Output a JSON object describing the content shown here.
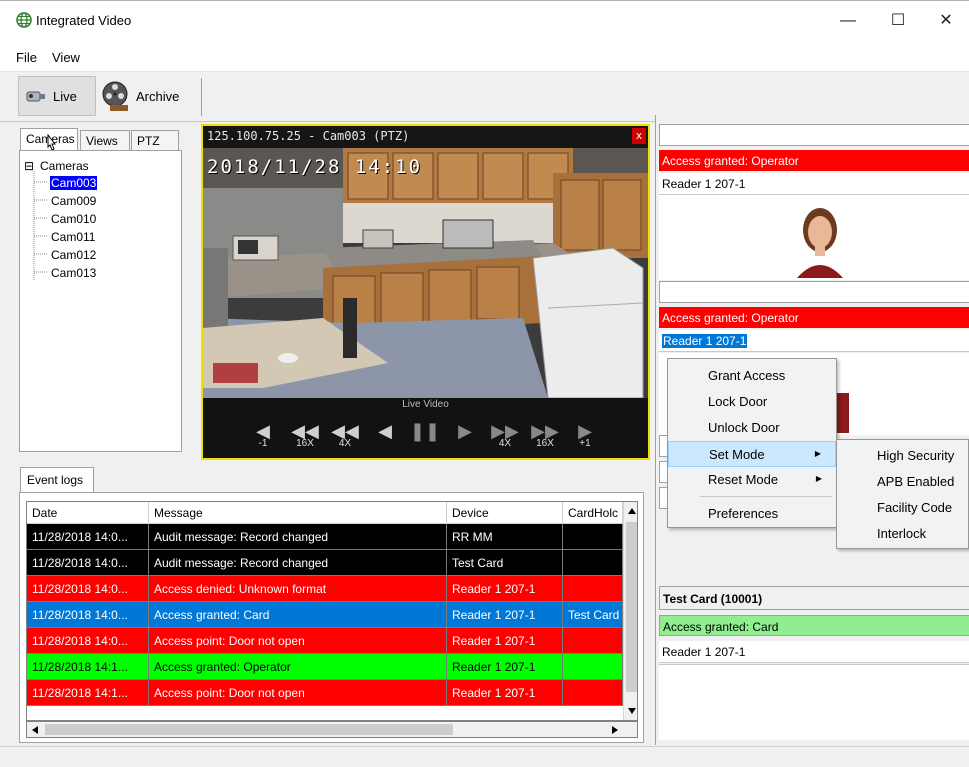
{
  "window": {
    "title": "Integrated Video",
    "minimize": "—",
    "maximize": "☐",
    "close": "✕"
  },
  "menu": {
    "file": "File",
    "view": "View"
  },
  "toolbar": {
    "live": "Live",
    "archive": "Archive"
  },
  "left_tabs": {
    "cameras": "Cameras",
    "views": "Views",
    "ptz": "PTZ"
  },
  "tree": {
    "root": "Cameras",
    "expander": "⊟",
    "items": [
      "Cam003",
      "Cam009",
      "Cam010",
      "Cam011",
      "Cam012",
      "Cam013"
    ]
  },
  "video": {
    "header": "125.100.75.25 - Cam003 (PTZ)",
    "close": "x",
    "timestamp": "2018/11/28 14:10",
    "label": "Live Video",
    "controls": {
      "step_back": "-1",
      "rew16": "16X",
      "rew4": "4X",
      "ff4": "4X",
      "ff16": "16X",
      "step_fwd": "+1"
    }
  },
  "eventlog": {
    "tab": "Event logs",
    "columns": [
      "Date",
      "Message",
      "Device",
      "CardHolc"
    ],
    "rows": [
      {
        "date": "11/28/2018 14:0...",
        "message": "Audit message: Record changed",
        "device": "RR MM",
        "cardholder": "",
        "bg": "#000000",
        "fg": "#ffffff"
      },
      {
        "date": "11/28/2018 14:0...",
        "message": "Audit message: Record changed",
        "device": "Test Card",
        "cardholder": "",
        "bg": "#000000",
        "fg": "#ffffff"
      },
      {
        "date": "11/28/2018 14:0...",
        "message": "Access denied: Unknown format",
        "device": "Reader 1 207-1",
        "cardholder": "",
        "bg": "#ff0000",
        "fg": "#ffffff"
      },
      {
        "date": "11/28/2018 14:0...",
        "message": "Access granted: Card",
        "device": "Reader 1 207-1",
        "cardholder": "Test Card",
        "bg": "#0078d7",
        "fg": "#ffffff"
      },
      {
        "date": "11/28/2018 14:0...",
        "message": "Access point: Door not open",
        "device": "Reader 1 207-1",
        "cardholder": "",
        "bg": "#ff0000",
        "fg": "#ffffff"
      },
      {
        "date": "11/28/2018 14:1...",
        "message": "Access granted: Operator",
        "device": "Reader 1 207-1",
        "cardholder": "",
        "bg": "#00ff00",
        "fg": "#000000"
      },
      {
        "date": "11/28/2018 14:1...",
        "message": "Access point: Door not open",
        "device": "Reader 1 207-1",
        "cardholder": "",
        "bg": "#ff0000",
        "fg": "#ffffff"
      }
    ]
  },
  "right_panel": {
    "event1": {
      "status": "Access granted: Operator",
      "reader": "Reader 1 207-1"
    },
    "event2": {
      "status": "Access granted: Operator",
      "reader": "Reader 1 207-1"
    },
    "event3": {
      "card": "Test Card (10001)",
      "status": "Access granted: Card",
      "reader": "Reader 1 207-1"
    }
  },
  "context_menu": {
    "items": [
      "Grant Access",
      "Lock Door",
      "Unlock Door",
      "Set Mode",
      "Reset Mode",
      "Preferences"
    ],
    "submenu_arrow": "▶"
  },
  "submenu": {
    "items": [
      "High Security",
      "APB Enabled",
      "Facility Code",
      "Interlock"
    ]
  },
  "colors": {
    "red": "#ff0000",
    "green_light": "#90ee90",
    "selection": "#0078d7",
    "menu_hover": "#cce8ff"
  }
}
